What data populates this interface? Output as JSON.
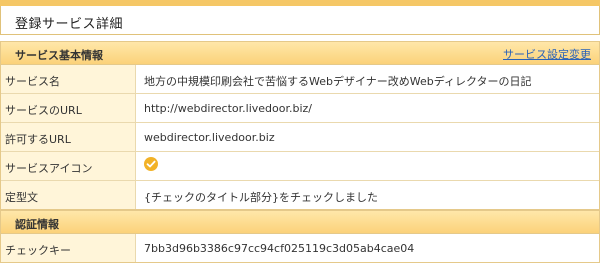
{
  "page": {
    "title": "登録サービス詳細"
  },
  "service_info": {
    "title": "サービス基本情報",
    "edit_link": "サービス設定変更",
    "rows": [
      {
        "label": "サービス名",
        "value": "地方の中規模印刷会社で苦悩するWebデザイナー改めWebディレクターの日記"
      },
      {
        "label": "サービスのURL",
        "value": "http://webdirector.livedoor.biz/"
      },
      {
        "label": "許可するURL",
        "value": "webdirector.livedoor.biz"
      },
      {
        "label": "サービスアイコン",
        "icon": "check-badge-icon",
        "icon_color": "#f2b227"
      },
      {
        "label": "定型文",
        "value": "{チェックのタイトル部分}をチェックしました"
      }
    ]
  },
  "auth_info": {
    "title": "認証情報",
    "rows": [
      {
        "label": "チェックキー",
        "value": "7bb3d96b3386c97cc94cf025119c3d05ab4cae04"
      }
    ]
  }
}
